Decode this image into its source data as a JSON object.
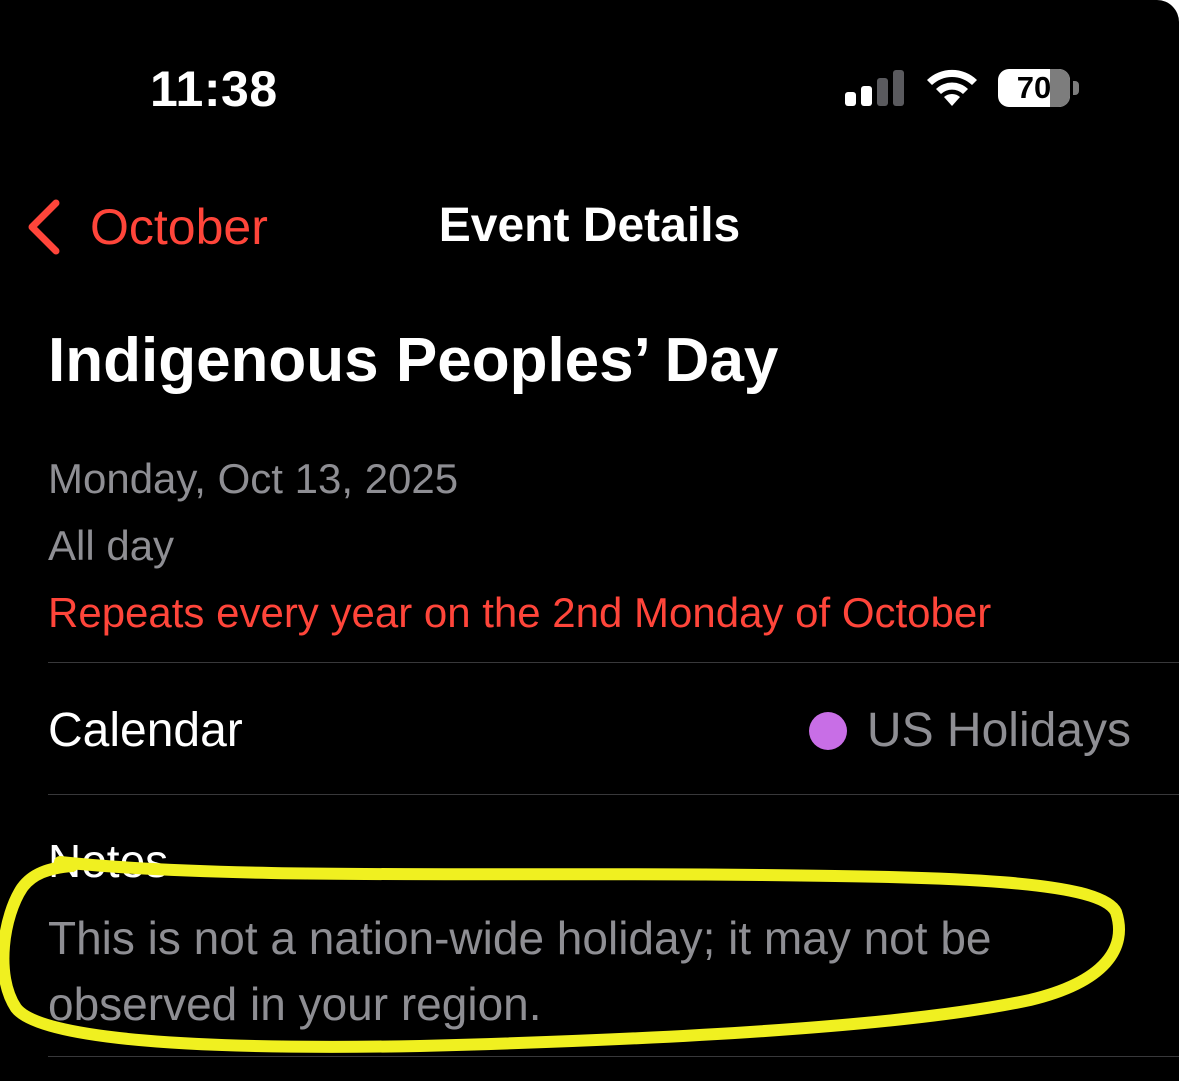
{
  "status_bar": {
    "time": "11:38",
    "battery_level": "70",
    "signal_icon": "cellular-signal-icon",
    "wifi_icon": "wifi-icon",
    "battery_icon": "battery-icon"
  },
  "nav": {
    "back_label": "October",
    "back_icon": "chevron-left-icon",
    "title": "Event Details"
  },
  "event": {
    "title": "Indigenous Peoples’ Day",
    "date": "Monday, Oct 13, 2025",
    "time": "All day",
    "repeat": "Repeats every year on the 2nd Monday of October"
  },
  "calendar": {
    "label": "Calendar",
    "value": "US Holidays",
    "color": "#c86ee6"
  },
  "notes": {
    "label": "Notes",
    "text": "This is not a nation-wide holiday; it may not be observed in your region."
  },
  "colors": {
    "background": "#000000",
    "accent": "#ff453a",
    "secondary_text": "#8e8e93",
    "annotation": "#f0f020"
  }
}
